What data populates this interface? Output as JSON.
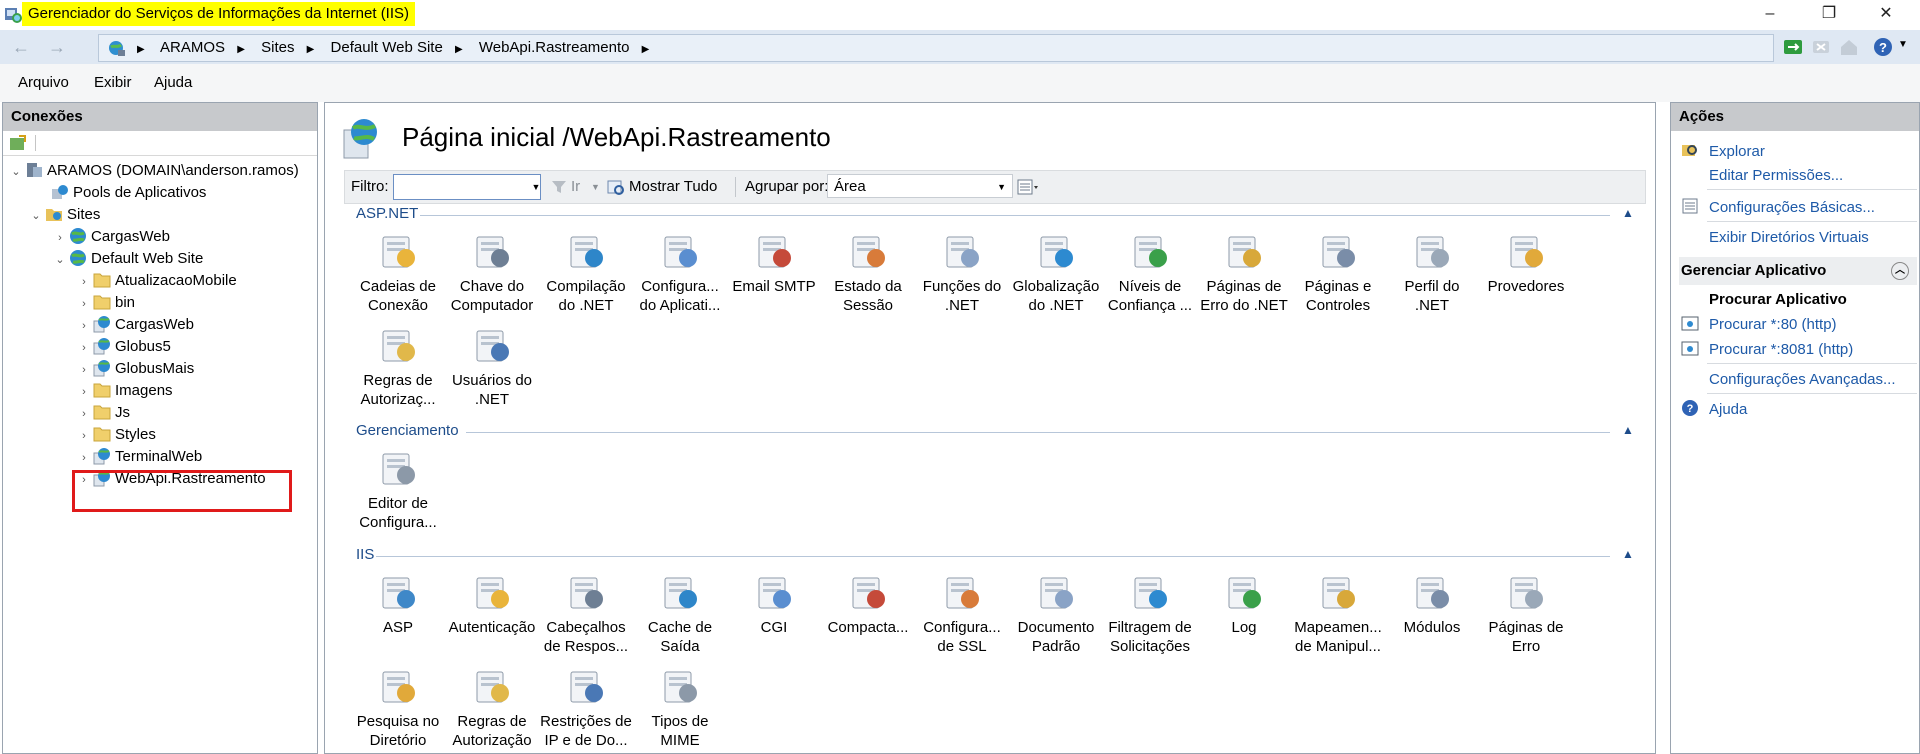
{
  "window": {
    "title": "Gerenciador do Serviços de Informações da Internet (IIS)",
    "controls": {
      "minimize": "–",
      "restore": "❐",
      "close": "✕"
    }
  },
  "address": {
    "back": "←",
    "forward": "→",
    "crumbs": [
      "ARAMOS",
      "Sites",
      "Default Web Site",
      "WebApi.Rastreamento"
    ]
  },
  "menu": {
    "file": "Arquivo",
    "view": "Exibir",
    "help": "Ajuda"
  },
  "connections": {
    "title": "Conexões",
    "tree": [
      {
        "label": "ARAMOS (DOMAIN\\anderson.ramos)",
        "icon": "server-icon"
      },
      {
        "label": "Pools de Aplicativos",
        "icon": "app-pools-icon"
      },
      {
        "label": "Sites",
        "icon": "sites-folder-icon"
      },
      {
        "label": "CargasWeb",
        "icon": "globe-icon"
      },
      {
        "label": "Default Web Site",
        "icon": "globe-icon"
      },
      {
        "label": "AtualizacaoMobile",
        "icon": "folder-icon"
      },
      {
        "label": "bin",
        "icon": "folder-icon"
      },
      {
        "label": "CargasWeb",
        "icon": "web-app-icon"
      },
      {
        "label": "Globus5",
        "icon": "web-app-icon"
      },
      {
        "label": "GlobusMais",
        "icon": "web-app-icon"
      },
      {
        "label": "Imagens",
        "icon": "folder-icon"
      },
      {
        "label": "Js",
        "icon": "folder-icon"
      },
      {
        "label": "Styles",
        "icon": "folder-icon"
      },
      {
        "label": "TerminalWeb",
        "icon": "web-app-icon"
      },
      {
        "label": "WebApi.Rastreamento",
        "icon": "web-app-icon"
      }
    ]
  },
  "main": {
    "title": "Página inicial /WebApi.Rastreamento",
    "filter_label": "Filtro:",
    "go_label": "Ir",
    "show_all_label": "Mostrar Tudo",
    "group_by_label": "Agrupar por:",
    "group_by_value": "Área",
    "sections": [
      {
        "name": "ASP.NET",
        "features": [
          [
            "Cadeias de",
            "Conexão"
          ],
          [
            "Chave do",
            "Computador"
          ],
          [
            "Compilação",
            "do .NET"
          ],
          [
            "Configura...",
            "do Aplicati..."
          ],
          [
            "Email SMTP",
            ""
          ],
          [
            "Estado da",
            "Sessão"
          ],
          [
            "Funções do",
            ".NET"
          ],
          [
            "Globalização",
            "do .NET"
          ],
          [
            "Níveis de",
            "Confiança ..."
          ],
          [
            "Páginas de",
            "Erro do .NET"
          ],
          [
            "Páginas e",
            "Controles"
          ],
          [
            "Perfil do .NET",
            ""
          ],
          [
            "Provedores",
            ""
          ],
          [
            "Regras de",
            "Autorizaç..."
          ],
          [
            "Usuários do",
            ".NET"
          ]
        ]
      },
      {
        "name": "Gerenciamento",
        "features": [
          [
            "Editor de",
            "Configura..."
          ]
        ]
      },
      {
        "name": "IIS",
        "features": [
          [
            "ASP",
            ""
          ],
          [
            "Autenticação",
            ""
          ],
          [
            "Cabeçalhos",
            "de Respos..."
          ],
          [
            "Cache de",
            "Saída"
          ],
          [
            "CGI",
            ""
          ],
          [
            "Compacta...",
            ""
          ],
          [
            "Configura...",
            "de SSL"
          ],
          [
            "Documento",
            "Padrão"
          ],
          [
            "Filtragem de",
            "Solicitações"
          ],
          [
            "Log",
            ""
          ],
          [
            "Mapeamen...",
            "de Manipul..."
          ],
          [
            "Módulos",
            ""
          ],
          [
            "Páginas de",
            "Erro"
          ],
          [
            "Pesquisa no",
            "Diretório"
          ],
          [
            "Regras de",
            "Autorização"
          ],
          [
            "Restrições de",
            "IP e de Do..."
          ],
          [
            "Tipos de",
            "MIME"
          ]
        ]
      }
    ]
  },
  "actions": {
    "title": "Ações",
    "explore": "Explorar",
    "edit_permissions": "Editar Permissões...",
    "basic_settings": "Configurações Básicas...",
    "view_virtual_dirs": "Exibir Diretórios Virtuais",
    "manage_app": "Gerenciar Aplicativo",
    "browse_app": "Procurar Aplicativo",
    "browse_80": "Procurar *:80 (http)",
    "browse_8081": "Procurar *:8081 (http)",
    "advanced_settings": "Configurações Avançadas...",
    "help": "Ajuda"
  },
  "colors": {
    "highlight": "#ffff00",
    "link": "#1e5aa8",
    "callout": "#e01a1a",
    "panel_header": "#c7c9cc"
  }
}
